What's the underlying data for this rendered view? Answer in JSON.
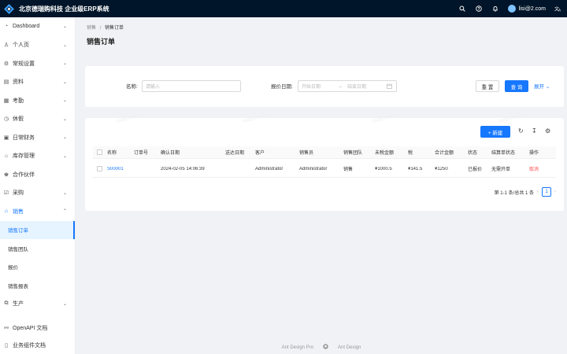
{
  "app": {
    "title": "北京德瑞购科技 企业级ERP系统"
  },
  "topbar": {
    "icons": [
      "search-icon",
      "question-icon",
      "bell-icon",
      "translate-icon"
    ],
    "user_name": "lisi@2.com"
  },
  "sidebar": {
    "items": [
      {
        "label": "Dashboard",
        "icon": "dashboard-icon",
        "glyph": "◔"
      },
      {
        "label": "个人页",
        "icon": "user-icon",
        "glyph": "♙"
      },
      {
        "label": "常规设置",
        "icon": "setting-icon",
        "glyph": "⚙"
      },
      {
        "label": "资料",
        "icon": "profile-icon",
        "glyph": "▤"
      },
      {
        "label": "考勤",
        "icon": "calendar-icon",
        "glyph": "▦"
      },
      {
        "label": "休假",
        "icon": "leave-icon",
        "glyph": "◷"
      },
      {
        "label": "日常财务",
        "icon": "finance-icon",
        "glyph": "▣"
      },
      {
        "label": "库存管理",
        "icon": "warehouse-icon",
        "glyph": "⌂"
      },
      {
        "label": "合作伙伴",
        "icon": "team-icon",
        "glyph": "♚"
      },
      {
        "label": "采购",
        "icon": "purchase-icon",
        "glyph": "☑"
      },
      {
        "label": "销售",
        "icon": "sales-icon",
        "glyph": "⌂"
      }
    ],
    "sales_sub": [
      "销售订单",
      "销售团队",
      "报价",
      "销售报表"
    ],
    "after": {
      "label": "生产",
      "icon": "production-icon",
      "glyph": "⧉"
    },
    "bottom": [
      {
        "label": "OpenAPI 文档",
        "icon": "link-icon",
        "glyph": "⚯"
      },
      {
        "label": "业务组件文档",
        "icon": "file-icon",
        "glyph": "▯"
      }
    ]
  },
  "breadcrumb": {
    "root": "销售",
    "sep": "/",
    "current": "销售订单"
  },
  "page": {
    "title": "销售订单"
  },
  "search": {
    "name_label": "名称:",
    "name_placeholder": "请输入",
    "date_label": "报价日期:",
    "start_placeholder": "开始日期",
    "arrow": "→",
    "end_placeholder": "结束日期",
    "reset": "重 置",
    "query": "查 询",
    "expand": "展开"
  },
  "toolbar": {
    "new": "+ 新建"
  },
  "watermark": "lisi@2.com",
  "table": {
    "columns": [
      "名称",
      "订单号",
      "确认日期",
      "送达日期",
      "客户",
      "销售员",
      "销售团队",
      "未税金额",
      "税",
      "合计金额",
      "状态",
      "结算单状态",
      "操作"
    ],
    "rows": [
      [
        "S00001",
        "",
        "2024-02-05 14:06:39",
        "",
        "Administrator",
        "Administrator",
        "销售",
        "¥1000.5",
        "¥141.5",
        "¥1250",
        "已报价",
        "无需开单",
        "取消"
      ]
    ]
  },
  "pagination": {
    "summary": "第 1-1 条/总共 1 条",
    "current": "1",
    "prev": "‹",
    "next": "›"
  },
  "footer": {
    "left": "Ant Design Pro",
    "right": "Ant Design"
  },
  "colors": {
    "primary": "#1677ff",
    "topbar": "#001529",
    "danger": "#ff4d4f"
  }
}
